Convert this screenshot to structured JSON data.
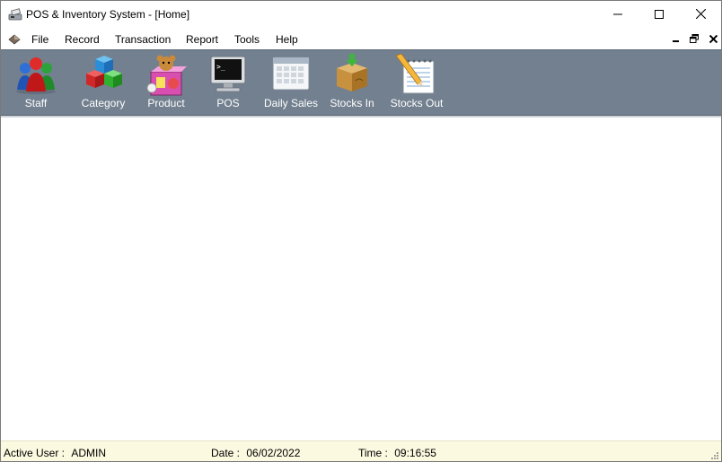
{
  "window": {
    "title": "POS & Inventory System - [Home]",
    "icons": {
      "app": "cash-register-icon",
      "minimize": "minimize-icon",
      "maximize": "maximize-icon",
      "close": "close-icon"
    }
  },
  "menu": {
    "items": [
      "File",
      "Record",
      "Transaction",
      "Report",
      "Tools",
      "Help"
    ]
  },
  "toolbar": {
    "items": [
      {
        "label": "Staff",
        "icon": "users-icon"
      },
      {
        "label": "Category",
        "icon": "cubes-icon"
      },
      {
        "label": "Product",
        "icon": "toy-box-icon"
      },
      {
        "label": "POS",
        "icon": "terminal-icon"
      },
      {
        "label": "Daily Sales",
        "icon": "calendar-icon"
      },
      {
        "label": "Stocks In",
        "icon": "box-in-icon"
      },
      {
        "label": "Stocks Out",
        "icon": "notepad-pencil-icon"
      }
    ]
  },
  "status": {
    "user_label": "Active User :",
    "user_value": "ADMIN",
    "date_label": "Date :",
    "date_value": "06/02/2022",
    "time_label": "Time :",
    "time_value": "09:16:55"
  },
  "colors": {
    "toolbar_bg": "#72808f",
    "status_bg": "#fbf9e0"
  }
}
